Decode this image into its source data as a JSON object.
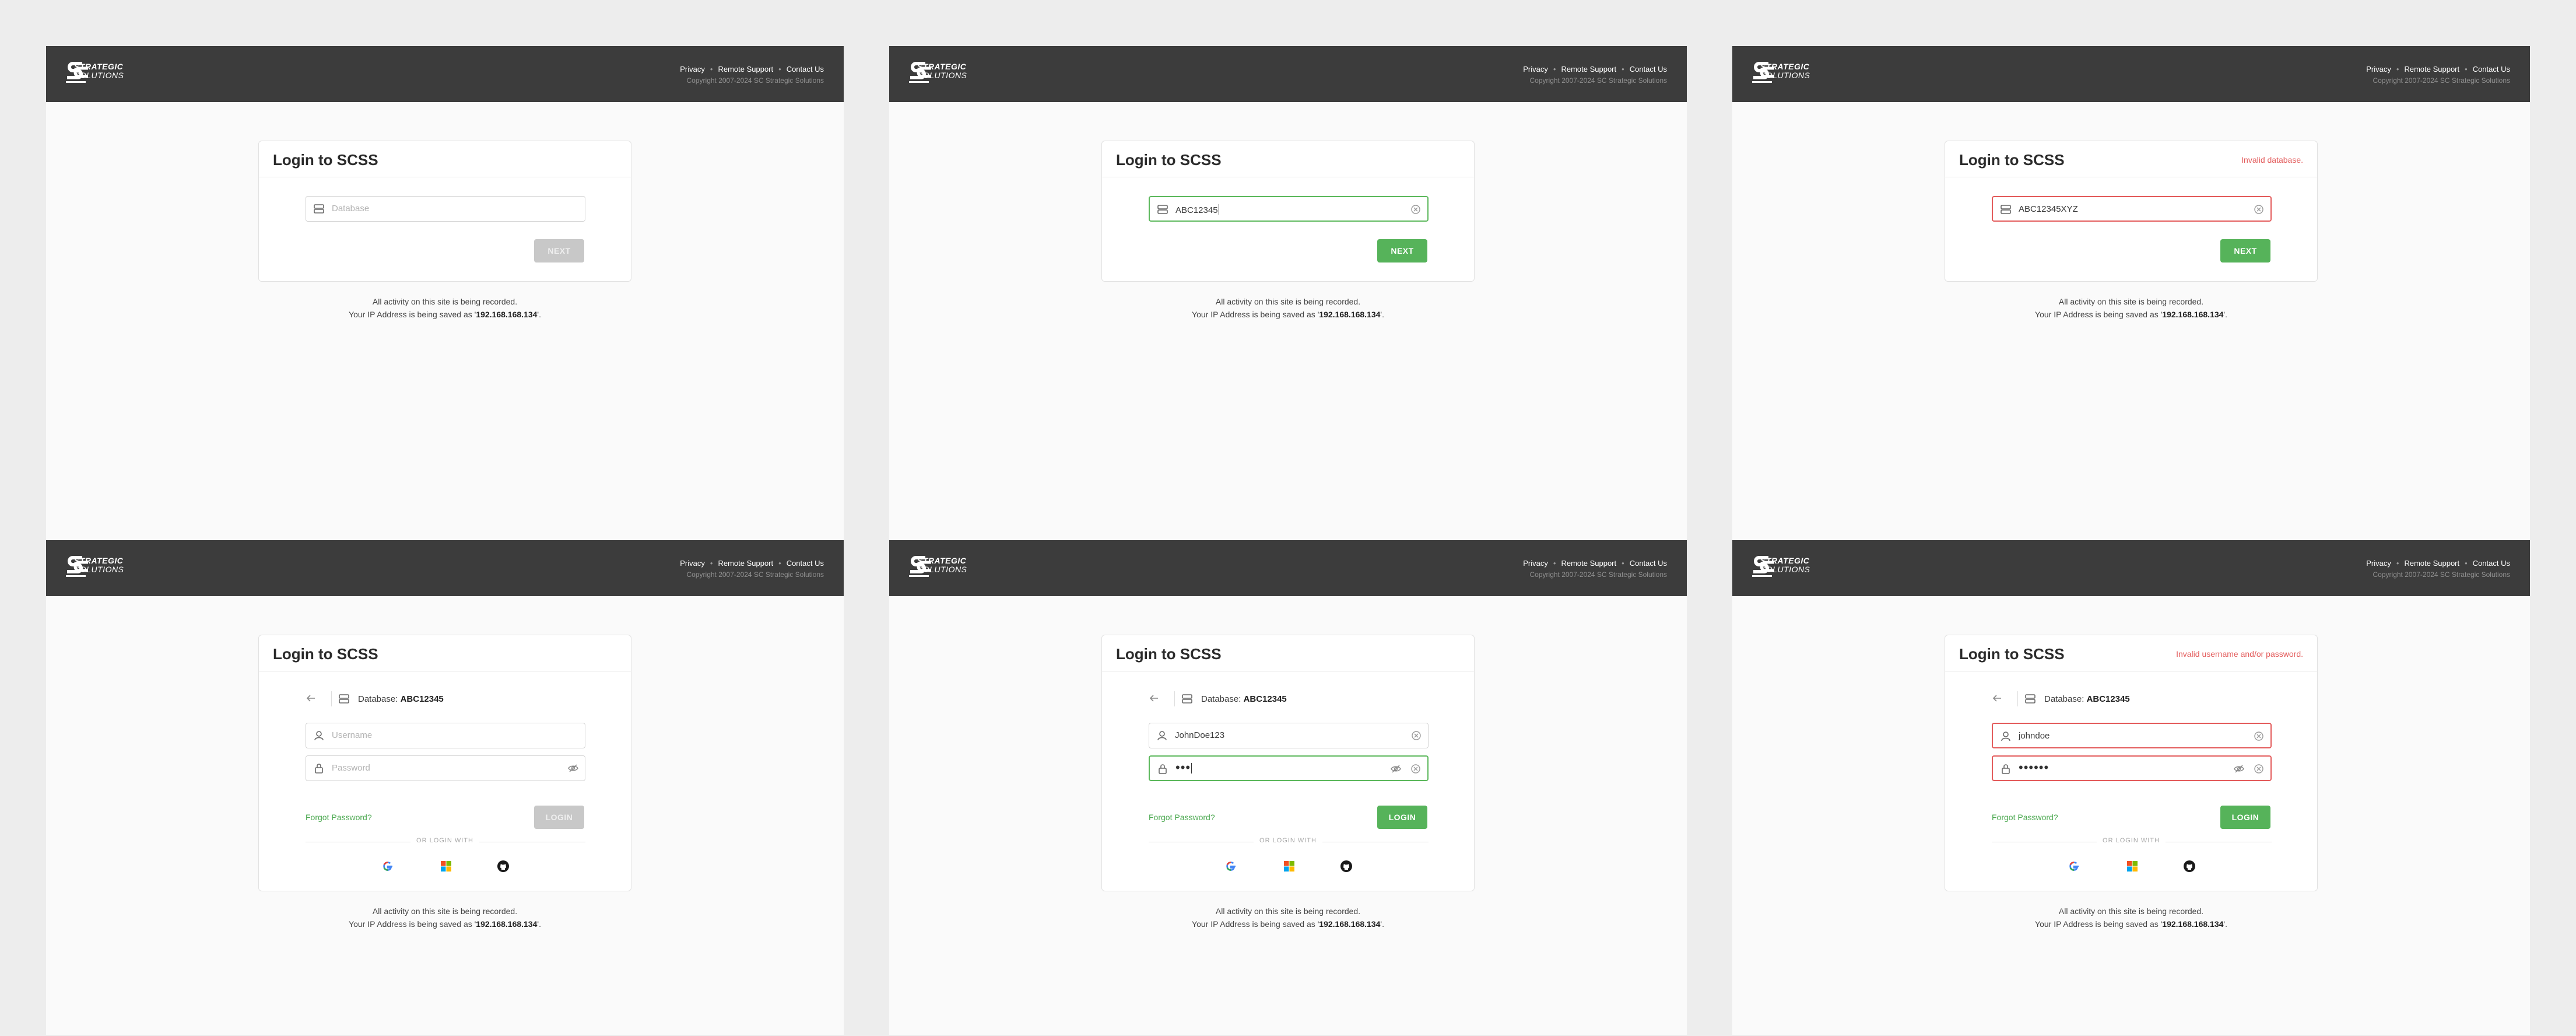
{
  "header": {
    "links": [
      "Privacy",
      "Remote Support",
      "Contact Us"
    ],
    "copyright": "Copyright 2007-2024 SC Strategic Solutions",
    "logo_line1": "STRATEGIC",
    "logo_line2": "SOLUTIONS"
  },
  "login": {
    "title": "Login to SCSS",
    "database_placeholder": "Database",
    "username_placeholder": "Username",
    "password_placeholder": "Password",
    "next_label": "NEXT",
    "login_label": "LOGIN",
    "forgot_label": "Forgot Password?",
    "or_login_with": "OR LOGIN WITH",
    "database_prefix": "Database:",
    "database_name": "ABC12345"
  },
  "notice": {
    "line1": "All activity on this site is being recorded.",
    "line2_prefix": "Your IP Address is being saved as '",
    "ip": "192.168.168.134",
    "line2_suffix": "'."
  },
  "states": {
    "s2_database": "ABC12345",
    "s3_database": "ABC12345XYZ",
    "s3_error": "Invalid database.",
    "s5_username": "JohnDoe123",
    "s5_password_mask": "•••",
    "s6_username": "johndoe",
    "s6_password_mask": "••••••",
    "s6_error": "Invalid username and/or password."
  },
  "colors": {
    "accent_green": "#56b35a",
    "error_red": "#e35b5b",
    "header_bg": "#3c3c3c"
  },
  "icons": [
    "database-icon",
    "user-icon",
    "lock-icon",
    "eye-off-icon",
    "clear-icon",
    "back-arrow-icon",
    "google-icon",
    "microsoft-icon",
    "github-icon"
  ]
}
